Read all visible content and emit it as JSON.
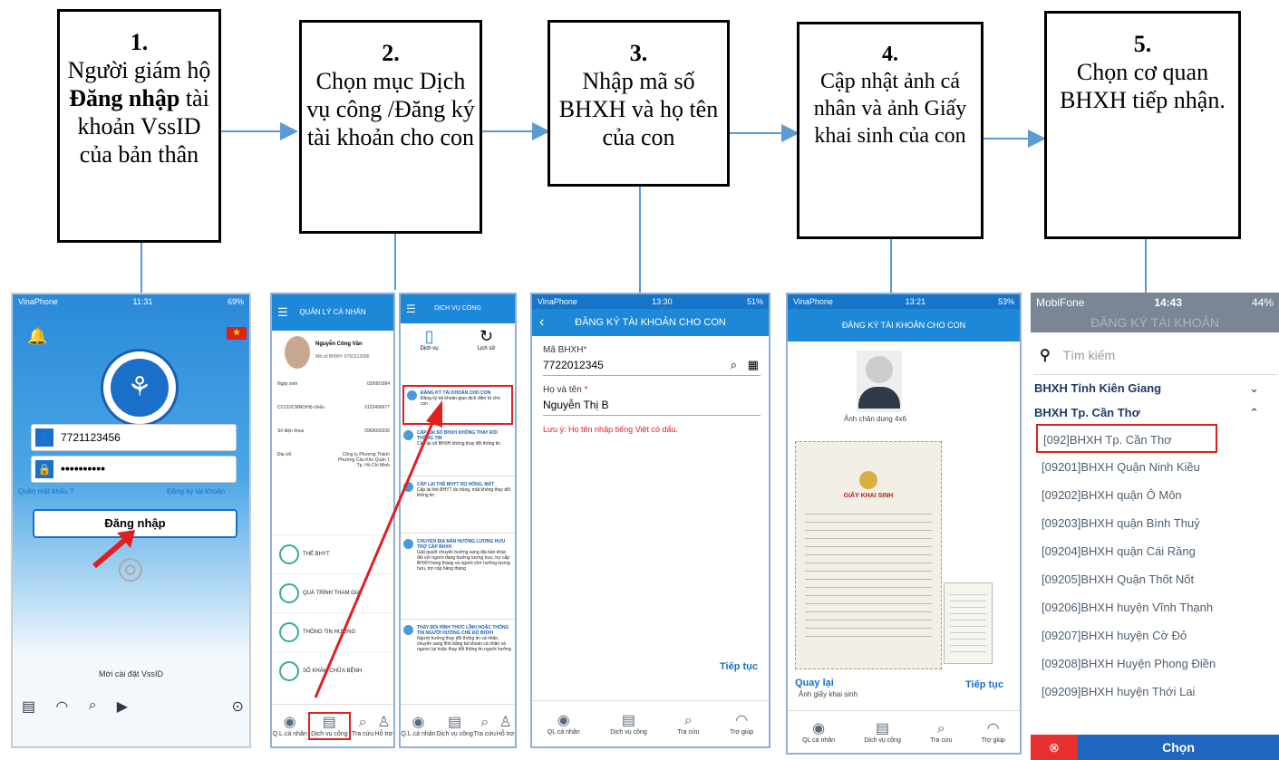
{
  "steps": [
    {
      "num": "1.",
      "pre": "Người giám hộ ",
      "bold": "Đăng nhập",
      "post": " tài khoản VssID của bản thân"
    },
    {
      "num": "2.",
      "text": "Chọn mục Dịch vụ công /Đăng ký tài khoản cho con"
    },
    {
      "num": "3.",
      "text": "Nhập mã số BHXH và họ tên của con"
    },
    {
      "num": "4.",
      "text": "Cập nhật ảnh cá nhân và ảnh Giấy khai sinh của con"
    },
    {
      "num": "5.",
      "text": "Chọn cơ quan BHXH tiếp nhận."
    }
  ],
  "login": {
    "carrier": "VinaPhone",
    "time": "11:31",
    "battery": "69%",
    "username": "7721123456",
    "password": "••••••••••",
    "forgot": "Quên mật khẩu ?",
    "register": "Đăng ký tài khoản",
    "login_btn": "Đăng nhập",
    "invite": "Mời cài đặt VssID"
  },
  "personal": {
    "title": "QUẢN LÝ CÁ NHÂN",
    "name": "Nguyễn Công Văn",
    "bhxh": "Mã số BHXH: 0791512096",
    "fields": [
      {
        "label": "Ngày sinh",
        "value": "03/09/1984"
      },
      {
        "label": "CCCD/CMND/Hộ chiếu",
        "value": "0123456677"
      },
      {
        "label": "Số điện thoại",
        "value": "0969000236"
      },
      {
        "label": "Địa chỉ",
        "value": "Công ty Phương Thành Phường Cầu Kho Quận 1 Tp. Hồ Chí Minh"
      }
    ],
    "menu": [
      "THẺ BHYT",
      "QUÁ TRÌNH THAM GIA",
      "THÔNG TIN HƯỞNG",
      "SỔ KHÁM CHỮA BỆNH"
    ],
    "tabs": [
      "Q.L.cá nhân",
      "Dịch vụ công",
      "Tra cứu",
      "Hỗ trợ"
    ]
  },
  "services": {
    "title": "DỊCH VỤ CÔNG",
    "tab1": "Dịch vụ",
    "tab2": "Lịch sử",
    "items": [
      {
        "title": "ĐĂNG KÝ TÀI KHOẢN CHO CON",
        "desc": "Đăng ký tài khoản giao dịch điện tử cho con"
      },
      {
        "title": "CẤP LẠI SỔ BHXH KHÔNG THAY ĐỔI THÔNG TIN",
        "desc": "Cấp lại sổ BHXH không thay đổi thông tin"
      },
      {
        "title": "CẤP LẠI THẺ BHYT DO HỎNG, MẤT",
        "desc": "Cấp lại thẻ BHYT do hỏng, mất không thay đổi thông tin"
      },
      {
        "title": "CHUYỂN ĐỊA BÀN HƯỞNG LƯƠNG HƯU TRỢ CẤP BHXH",
        "desc": "Giải quyết chuyển hưởng sang địa bàn khác đối với người đang hưởng lương hưu, trợ cấp BHXH hàng tháng và người chờ hưởng lương hưu, trợ cấp hàng tháng"
      },
      {
        "title": "THAY ĐỔI HÌNH THỨC LĨNH HOẶC THÔNG TIN NGƯỜI HƯỞNG CHẾ ĐỘ BHXH",
        "desc": "Người hưởng thay đổi thông tin cá nhân, chuyển sang lĩnh bằng tài khoản cá nhân và ngược lại hoặc thay đổi thông tin người hưởng"
      }
    ],
    "tabs": [
      "Q.L.cá nhân",
      "Dịch vụ công",
      "Tra cứu",
      "Hỗ trợ"
    ]
  },
  "register": {
    "carrier": "VinaPhone",
    "time": "13:30",
    "battery": "51%",
    "title": "ĐĂNG KÝ TÀI KHOẢN CHO CON",
    "bhxh_label": "Mã BHXH",
    "bhxh_value": "7722012345",
    "name_label": "Họ và tên",
    "name_value": "Nguyễn Thị B",
    "note": "Lưu ý: Họ tên nhập tiếng Việt có dấu.",
    "continue": "Tiếp tục",
    "tabs": [
      "QL cá nhân",
      "Dịch vụ công",
      "Tra cứu",
      "Trợ giúp"
    ]
  },
  "photo": {
    "carrier": "VinaPhone",
    "time": "13:21",
    "battery": "53%",
    "title": "ĐĂNG KÝ TÀI KHOẢN CHO CON",
    "portrait_caption": "Ảnh chân dung 4x6",
    "cert_title": "GIẤY KHAI SINH",
    "cert_caption": "Ảnh giấy khai sinh",
    "back": "Quay lại",
    "continue": "Tiếp tục",
    "tabs": [
      "QL cá nhân",
      "Dịch vụ công",
      "Tra cứu",
      "Trợ giúp"
    ]
  },
  "agency": {
    "carrier": "MobiFone",
    "time": "14:43",
    "battery": "44%",
    "title": "ĐĂNG KÝ TÀI KHOẢN",
    "search": "Tìm kiếm",
    "group1": "BHXH Tỉnh Kiên Giang",
    "group2": "BHXH Tp. Cần Thơ",
    "items": [
      "[092]BHXH Tp. Cần Thơ",
      "[09201]BHXH  Quận Ninh Kiều",
      "[09202]BHXH quận Ô Môn",
      "[09203]BHXH quận Bình Thuỷ",
      "[09204]BHXH quận Cái Răng",
      "[09205]BHXH Quận Thốt Nốt",
      "[09206]BHXH huyện Vĩnh Thạnh",
      "[09207]BHXH huyện Cờ Đỏ",
      "[09208]BHXH Huyện Phong Điền",
      "[09209]BHXH huyện Thới Lai"
    ],
    "choose": "Chọn"
  },
  "colors": {
    "arrow": "#5b9bd5",
    "header": "#1e88d8",
    "highlight": "#e02020"
  }
}
